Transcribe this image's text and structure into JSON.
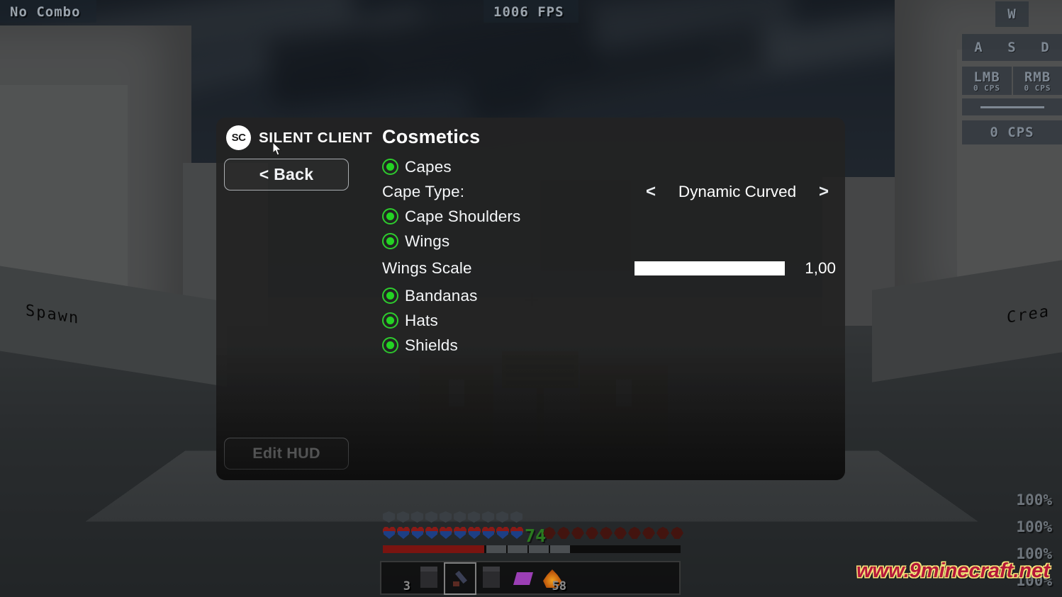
{
  "hud": {
    "combo": "No Combo",
    "fps": "1006 FPS",
    "keys": [
      {
        "name": "key-w",
        "label": "W",
        "sub": ""
      },
      {
        "name": "key-a",
        "label": "A",
        "sub": ""
      },
      {
        "name": "key-s",
        "label": "S",
        "sub": ""
      },
      {
        "name": "key-d",
        "label": "D",
        "sub": ""
      },
      {
        "name": "key-lmb",
        "label": "LMB",
        "sub": "0 CPS"
      },
      {
        "name": "key-rmb",
        "label": "RMB",
        "sub": "0 CPS"
      }
    ],
    "cps": "0 CPS",
    "durability": [
      "100%",
      "100%",
      "100%",
      "100%"
    ],
    "health_value": "74",
    "hotbar_items": [
      {
        "slot": 1,
        "count": "3"
      },
      {
        "slot": 2,
        "count": ""
      },
      {
        "slot": 3,
        "count": ""
      },
      {
        "slot": 4,
        "count": ""
      },
      {
        "slot": 5,
        "count": ""
      },
      {
        "slot": 6,
        "count": "58"
      }
    ],
    "watermark": "www.9minecraft.net"
  },
  "world": {
    "sign_left": "Spawn",
    "sign_right": "Crea"
  },
  "panel": {
    "brand_initials": "SC",
    "brand_name": "SILENT CLIENT",
    "back_label": "< Back",
    "edit_hud_label": "Edit HUD",
    "title": "Cosmetics",
    "rows": [
      {
        "name": "capes",
        "type": "toggle",
        "label": "Capes",
        "on": true
      },
      {
        "name": "cape-type",
        "type": "selector",
        "label": "Cape Type:",
        "value": "Dynamic Curved",
        "prev": "<",
        "next": ">"
      },
      {
        "name": "cape-shoulders",
        "type": "toggle",
        "label": "Cape Shoulders",
        "on": true
      },
      {
        "name": "wings",
        "type": "toggle",
        "label": "Wings",
        "on": true
      },
      {
        "name": "wings-scale",
        "type": "slider",
        "label": "Wings Scale",
        "value": "1,00",
        "fill_pct": 100
      },
      {
        "name": "bandanas",
        "type": "toggle",
        "label": "Bandanas",
        "on": true
      },
      {
        "name": "hats",
        "type": "toggle",
        "label": "Hats",
        "on": true
      },
      {
        "name": "shields",
        "type": "toggle",
        "label": "Shields",
        "on": true
      }
    ]
  },
  "colors": {
    "panel_bg": "#222222",
    "toggle_green": "#23d423",
    "text_primary": "#f4f6f8",
    "health_green": "#2a7a1f",
    "watermark_red": "#b4173a"
  }
}
